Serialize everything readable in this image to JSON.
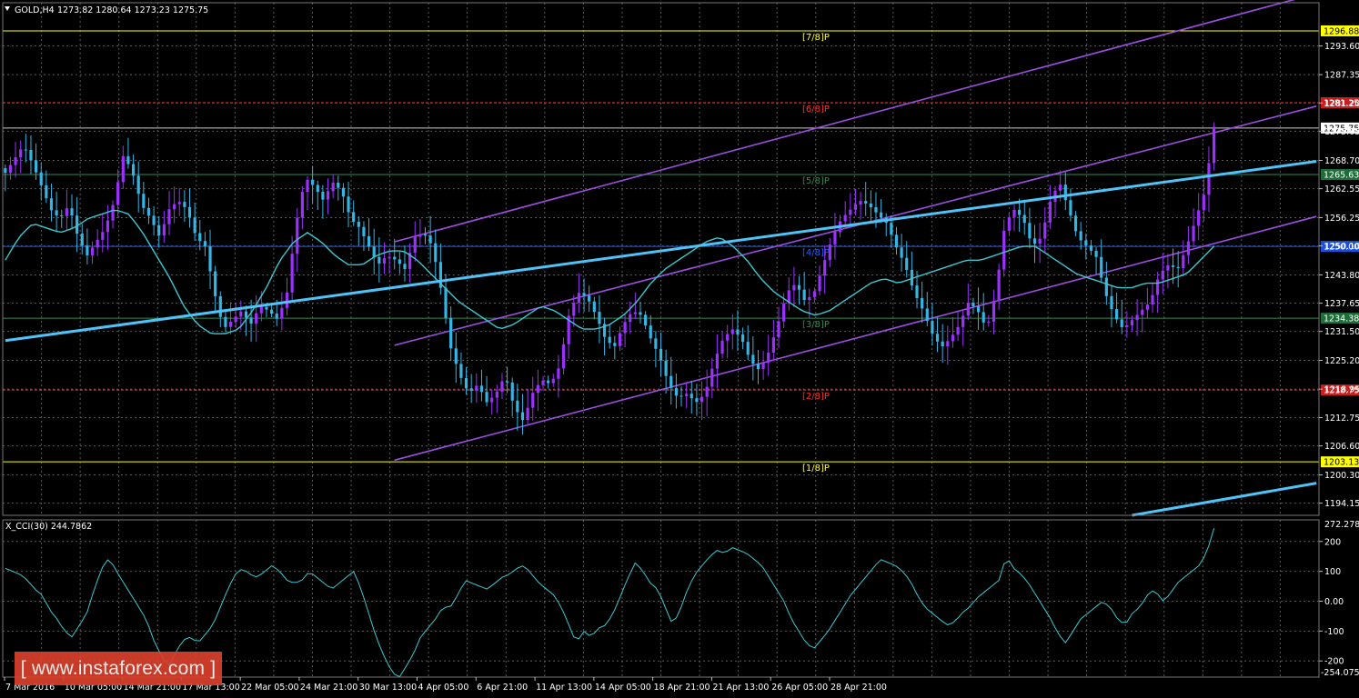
{
  "header": {
    "symbol": "GOLD,H4",
    "ohlc": "1273.82 1280.64 1273.23 1275.75"
  },
  "indicator_header": "X_CCI(30) 244.7862",
  "watermark": "[ www.instaforex.com ]",
  "colors": {
    "background": "#000000",
    "grid": "#5a5a5a",
    "bull": "#9b30ff",
    "bear": "#33b5e5",
    "ma": "#3cc8d0",
    "trend": "#4fc3f7",
    "channel": "#9b4fe0",
    "yellow": "#ffff00",
    "red": "#ff2b2b",
    "green": "#2e8b57",
    "blue": "#1e5bff",
    "white": "#ffffff"
  },
  "chart_data": [
    {
      "type": "candlestick",
      "symbol": "GOLD",
      "timeframe": "H4",
      "ylim": [
        1191.5,
        1303.0
      ],
      "y_ticks": [
        "1293.60",
        "1287.35",
        "1281.20",
        "1275.05",
        "1268.70",
        "1262.55",
        "1256.25",
        "1250.10",
        "1243.80",
        "1237.65",
        "1231.50",
        "1225.20",
        "1218.95",
        "1212.75",
        "1206.60",
        "1200.30",
        "1194.15"
      ],
      "x_labels": [
        "7 Mar 2016",
        "10 Mar 05:00",
        "14 Mar 21:00",
        "17 Mar 13:00",
        "22 Mar 05:00",
        "24 Mar 21:00",
        "30 Mar 13:00",
        "4 Apr 05:00",
        "6 Apr 21:00",
        "11 Apr 13:00",
        "14 Apr 05:00",
        "18 Apr 21:00",
        "21 Apr 13:00",
        "26 Apr 05:00",
        "28 Apr 21:00"
      ],
      "price_path": [
        1266,
        1269,
        1272,
        1268,
        1263,
        1258,
        1256,
        1259,
        1252,
        1248,
        1251,
        1254,
        1260,
        1270,
        1266,
        1259,
        1256,
        1252,
        1258,
        1260,
        1258,
        1252,
        1250,
        1240,
        1232,
        1234,
        1236,
        1233,
        1237,
        1236,
        1234,
        1240,
        1255,
        1265,
        1263,
        1260,
        1264,
        1262,
        1256,
        1254,
        1250,
        1246,
        1248,
        1247,
        1245,
        1252,
        1253,
        1250,
        1240,
        1228,
        1222,
        1218,
        1220,
        1216,
        1218,
        1222,
        1215,
        1212,
        1218,
        1221,
        1220,
        1224,
        1235,
        1240,
        1239,
        1235,
        1230,
        1228,
        1233,
        1236,
        1235,
        1230,
        1226,
        1220,
        1217,
        1218,
        1216,
        1218,
        1225,
        1230,
        1232,
        1230,
        1225,
        1223,
        1227,
        1233,
        1240,
        1242,
        1238,
        1240,
        1246,
        1252,
        1256,
        1258,
        1260,
        1259,
        1257,
        1255,
        1250,
        1246,
        1240,
        1236,
        1231,
        1228,
        1230,
        1233,
        1238,
        1236,
        1232,
        1240,
        1255,
        1258,
        1256,
        1250,
        1252,
        1260,
        1264,
        1258,
        1252,
        1250,
        1248,
        1240,
        1235,
        1232,
        1234,
        1236,
        1238,
        1244,
        1246,
        1245,
        1250,
        1256,
        1262,
        1276
      ],
      "moving_average_path": [
        1247,
        1252,
        1255,
        1254,
        1253,
        1254,
        1256,
        1257,
        1258,
        1257,
        1253,
        1248,
        1243,
        1237,
        1233,
        1231,
        1231,
        1232,
        1236,
        1241,
        1247,
        1251,
        1253,
        1251,
        1248,
        1246,
        1246,
        1248,
        1249,
        1249,
        1247,
        1244,
        1241,
        1238,
        1236,
        1234,
        1232,
        1233,
        1235,
        1237,
        1236,
        1234,
        1232,
        1232,
        1233,
        1235,
        1238,
        1242,
        1245,
        1247,
        1249,
        1251,
        1252,
        1250,
        1247,
        1243,
        1240,
        1238,
        1236,
        1235,
        1236,
        1238,
        1240,
        1242,
        1243,
        1242,
        1243,
        1244,
        1245,
        1246,
        1247,
        1247,
        1248,
        1249,
        1250,
        1250,
        1248,
        1246,
        1244,
        1243,
        1242,
        1241,
        1241,
        1242,
        1242,
        1243,
        1244,
        1247,
        1250
      ],
      "murrey_levels": [
        {
          "label": "[7/8]P",
          "price": "1296.88",
          "value": 1296.88,
          "color": "yellow"
        },
        {
          "label": "[6/8]P",
          "price": "1281.25",
          "value": 1281.25,
          "color": "red"
        },
        {
          "label": "[5/8]P",
          "price": "1265.63",
          "value": 1265.63,
          "color": "green"
        },
        {
          "label": "[4/8]P",
          "price": "1250.00",
          "value": 1250.0,
          "color": "blue"
        },
        {
          "label": "[3/8]P",
          "price": "1234.38",
          "value": 1234.38,
          "color": "green"
        },
        {
          "label": "[2/8]P",
          "price": "1218.75",
          "value": 1218.75,
          "color": "red"
        },
        {
          "label": "[1/8]P",
          "price": "1203.13",
          "value": 1203.13,
          "color": "yellow"
        }
      ],
      "current_price": "1275.75",
      "current_value": 1275.75,
      "channel": {
        "start_index": 76,
        "end_index": 256,
        "lower_start": 1203.5,
        "lower_end": 1256.5,
        "middle_start": 1228.5,
        "middle_end": 1280.5,
        "upper_start": 1251,
        "upper_end": 1305
      },
      "trend_lines": [
        {
          "start_index": 0,
          "start": 1229.5,
          "end_index": 256,
          "end": 1268.5
        },
        {
          "start_index": 220,
          "start": 1191.5,
          "end_index": 256,
          "end": 1198.5
        }
      ]
    },
    {
      "type": "line",
      "name": "X_CCI(30)",
      "value": "244.7862",
      "ylim": [
        -254.0753,
        272.278
      ],
      "y_ticks": [
        "200",
        "100",
        "0.00",
        "-100",
        "-200"
      ],
      "top_label": "272.278",
      "bottom_label": "-254.0753",
      "values": [
        110,
        100,
        90,
        70,
        40,
        20,
        -30,
        -60,
        -100,
        -120,
        -80,
        -40,
        40,
        110,
        145,
        100,
        60,
        20,
        -20,
        -60,
        -130,
        -180,
        -220,
        -170,
        -130,
        -120,
        -140,
        -110,
        -80,
        -20,
        40,
        90,
        110,
        90,
        80,
        100,
        120,
        100,
        70,
        60,
        70,
        100,
        80,
        60,
        40,
        60,
        80,
        100,
        40,
        -40,
        -120,
        -180,
        -230,
        -260,
        -220,
        -180,
        -120,
        -90,
        -60,
        -20,
        -20,
        20,
        70,
        60,
        50,
        40,
        60,
        80,
        90,
        110,
        120,
        90,
        60,
        40,
        20,
        -20,
        -80,
        -140,
        -100,
        -120,
        -90,
        -80,
        -40,
        20,
        80,
        130,
        100,
        60,
        40,
        -20,
        -80,
        -30,
        40,
        90,
        120,
        150,
        170,
        160,
        180,
        170,
        160,
        140,
        120,
        80,
        40,
        0,
        -60,
        -100,
        -140,
        -160,
        -130,
        -100,
        -60,
        -20,
        20,
        50,
        80,
        110,
        140,
        130,
        120,
        100,
        70,
        20,
        -20,
        -40,
        -60,
        -80,
        -70,
        -40,
        -20,
        10,
        30,
        50,
        70,
        150,
        110,
        90,
        60,
        20,
        -20,
        -60,
        -110,
        -140,
        -100,
        -60,
        -40,
        -20,
        0,
        -20,
        -60,
        -80,
        -40,
        -20,
        20,
        40,
        0,
        20,
        60,
        80,
        100,
        120,
        160,
        244
      ]
    }
  ]
}
